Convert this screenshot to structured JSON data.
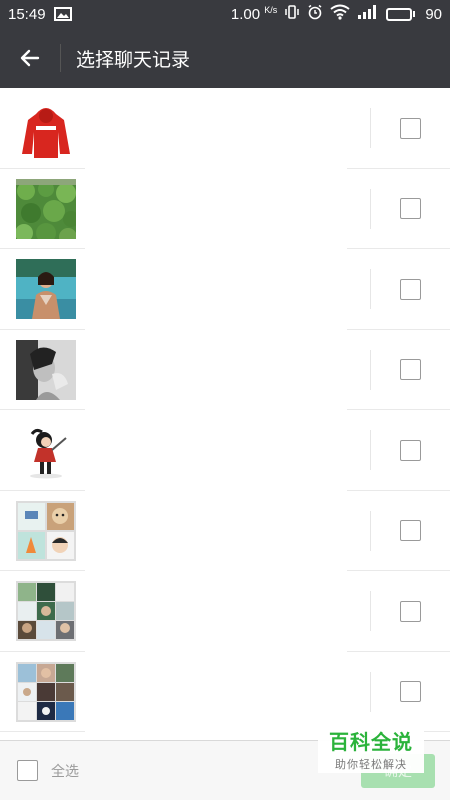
{
  "status": {
    "time": "15:49",
    "speed_value": "1.00",
    "speed_unit": "K/s",
    "battery": "90",
    "icons": [
      "image-notification-icon",
      "vibrate-icon",
      "alarm-icon",
      "wifi-icon",
      "signal-icon",
      "battery-icon"
    ]
  },
  "header": {
    "back_icon": "arrow-left-icon",
    "title": "选择聊天记录"
  },
  "rows": [
    {
      "avatar": "red-hoodie-photo"
    },
    {
      "avatar": "green-leaves-photo"
    },
    {
      "avatar": "woman-lake-photo"
    },
    {
      "avatar": "grayscale-portrait-photo"
    },
    {
      "avatar": "cartoon-girl-drawing"
    },
    {
      "avatar": "group-avatar-4"
    },
    {
      "avatar": "group-avatar-9a"
    },
    {
      "avatar": "group-avatar-9b"
    }
  ],
  "footer": {
    "select_all": "全选",
    "confirm": "确定"
  },
  "watermark": {
    "title": "百科全说",
    "subtitle": "助你轻松解决"
  },
  "colors": {
    "header_bg": "#393a3f",
    "confirm_bg": "#a8e0b0",
    "watermark_green": "#2bb33b"
  }
}
